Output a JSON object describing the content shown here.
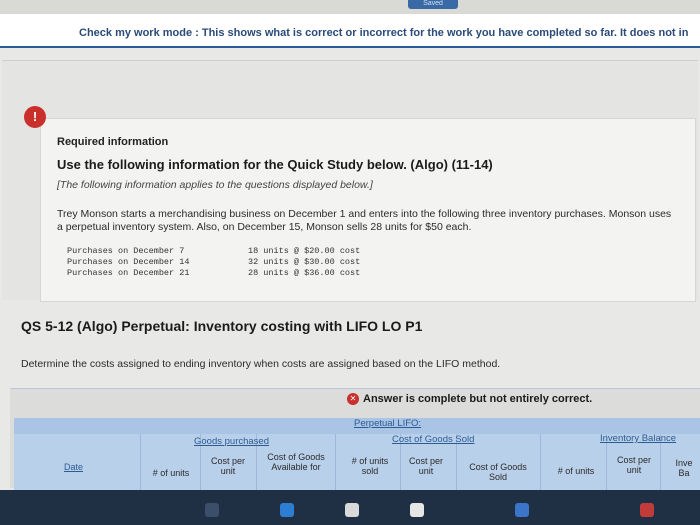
{
  "header": {
    "saved_tab": "Saved",
    "banner": "Check my work mode : This shows what is correct or incorrect for the work you have completed so far. It does not in"
  },
  "alert_icon": "!",
  "question": {
    "required_title": "Required information",
    "use_line": "Use the following information for the Quick Study below. (Algo) (11-14)",
    "note": "[The following information applies to the questions displayed below.]",
    "paragraph": "Trey Monson starts a merchandising business on December 1 and enters into the following three inventory purchases. Monson uses a perpetual inventory system. Also, on December 15, Monson sells 28 units for $50 each.",
    "purchases": [
      {
        "label": "Purchases on December 7",
        "value": "18 units @ $20.00 cost"
      },
      {
        "label": "Purchases on December 14",
        "value": "32 units @ $30.00 cost"
      },
      {
        "label": "Purchases on December 21",
        "value": "28 units @ $36.00 cost"
      }
    ]
  },
  "qs": {
    "title": "QS 5-12 (Algo) Perpetual: Inventory costing with LIFO LO P1",
    "determine": "Determine the costs assigned to ending inventory when costs are assigned based on the LIFO method."
  },
  "answer": {
    "status": "Answer is complete but not entirely correct."
  },
  "table": {
    "perpetual_label": "Perpetual LIFO:",
    "goods_purchased": "Goods purchased",
    "cogs_sold": "Cost of Goods Sold",
    "inventory_balance": "Inventory Balance",
    "date": "Date",
    "units": "# of units",
    "cost_per": "Cost per unit",
    "cost_goods_available": "Cost of Goods Available for",
    "units_sold": "# of units sold",
    "cost_per_2": "Cost per unit",
    "cost_goods_sold": "Cost of Goods Sold",
    "units_3": "# of units",
    "cost_per_3": "Cost per unit",
    "inv_bal_partial": "Inve Ba"
  },
  "colors": {
    "banner_text": "#2a4a7a",
    "alert": "#c9302c",
    "link": "#2d5b93",
    "table_header": "#a9c4e4"
  },
  "icons": [
    "alert-icon",
    "error-x-icon"
  ]
}
